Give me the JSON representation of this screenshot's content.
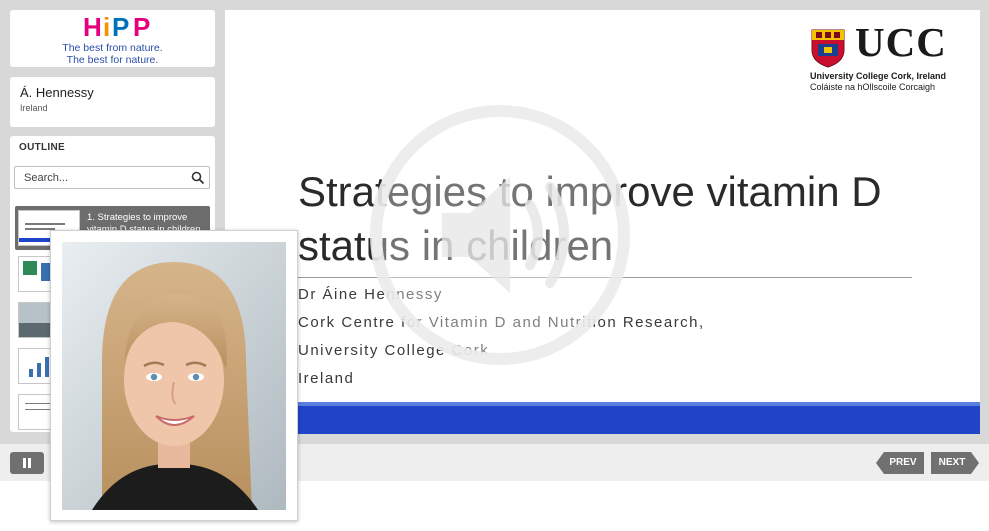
{
  "brand": {
    "logo_text": "HiPP",
    "tagline_1": "The best from nature.",
    "tagline_2": "The best for nature."
  },
  "presenter": {
    "name": "Á. Hennessy",
    "location": "Ireland"
  },
  "outline": {
    "heading": "OUTLINE",
    "search_placeholder": "Search...",
    "items": [
      {
        "label": "1. Strategies to improve vitamin D status in children",
        "active": true
      },
      {
        "label": "",
        "active": false
      },
      {
        "label": "",
        "active": false
      },
      {
        "label": "",
        "active": false
      },
      {
        "label": "",
        "active": false
      }
    ]
  },
  "slide": {
    "logo_text": "UCC",
    "logo_sub_1": "University College Cork, Ireland",
    "logo_sub_2": "Coláiste na hOllscoile Corcaigh",
    "title": "Strategies to improve vitamin D status in children",
    "author": "Dr Áine Hennessy",
    "affiliation_1": "Cork Centre for Vitamin D and Nutrition Research,",
    "affiliation_2": "University College Cork",
    "affiliation_3": "Ireland"
  },
  "player": {
    "prev_label": "PREV",
    "next_label": "NEXT"
  },
  "colors": {
    "accent_blue": "#1f44c8",
    "button_gray": "#707070",
    "tagline_blue": "#2b4fa8"
  }
}
